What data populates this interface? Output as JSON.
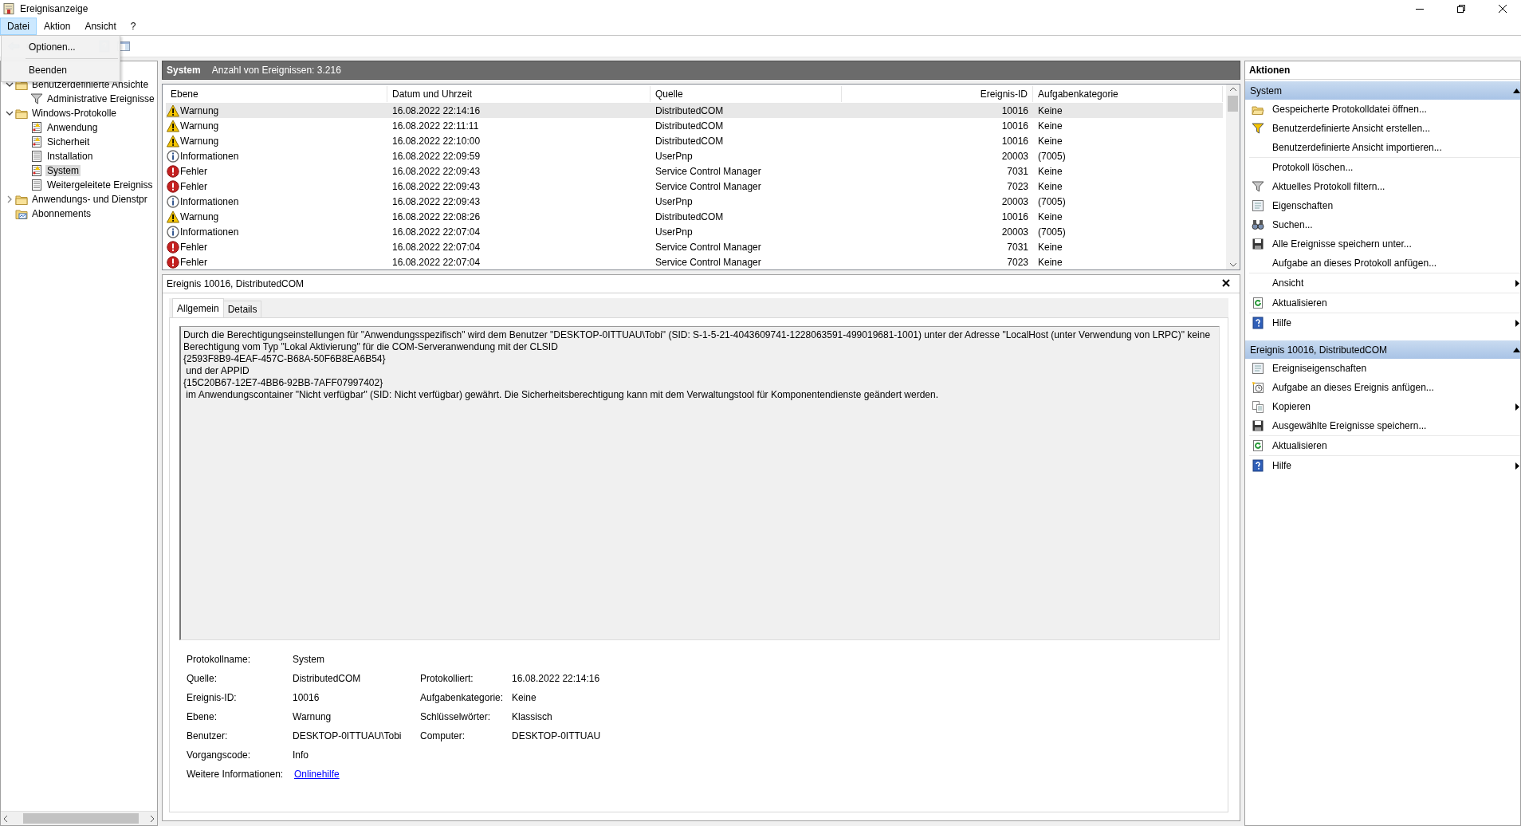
{
  "window": {
    "title": "Ereignisanzeige"
  },
  "menu": [
    {
      "label": "Datei",
      "selected": true
    },
    {
      "label": "Aktion",
      "selected": false
    },
    {
      "label": "Ansicht",
      "selected": false
    },
    {
      "label": "?",
      "selected": false
    }
  ],
  "open_menu": {
    "items": [
      "Optionen...",
      "Beenden"
    ]
  },
  "tree": [
    {
      "label": "Benutzerdefinierte Ansichte",
      "kind": "folder",
      "expanded": true,
      "selected": false,
      "children": [
        {
          "label": "Administrative Ereignisse",
          "kind": "custom_view",
          "selected": false
        }
      ]
    },
    {
      "label": "Windows-Protokolle",
      "kind": "folder",
      "expanded": true,
      "selected": false,
      "children": [
        {
          "label": "Anwendung",
          "kind": "log",
          "selected": false
        },
        {
          "label": "Sicherheit",
          "kind": "log",
          "selected": false
        },
        {
          "label": "Installation",
          "kind": "plain_log",
          "selected": false
        },
        {
          "label": "System",
          "kind": "log",
          "selected": true
        },
        {
          "label": "Weitergeleitete Ereigniss",
          "kind": "plain_log",
          "selected": false
        }
      ]
    },
    {
      "label": "Anwendungs- und Dienstpr",
      "kind": "folder",
      "expanded": false,
      "selected": false
    },
    {
      "label": "Abonnements",
      "kind": "subscriptions",
      "selected": false
    }
  ],
  "log_header": {
    "title": "System",
    "count": "Anzahl von Ereignissen: 3.216"
  },
  "table": {
    "columns": [
      "Ebene",
      "Datum und Uhrzeit",
      "Quelle",
      "Ereignis-ID",
      "Aufgabenkategorie"
    ],
    "rows": [
      {
        "kind": "warning",
        "level": "Warnung",
        "date": "16.08.2022 22:14:16",
        "source": "DistributedCOM",
        "id": "10016",
        "category": "Keine",
        "selected": true
      },
      {
        "kind": "warning",
        "level": "Warnung",
        "date": "16.08.2022 22:11:11",
        "source": "DistributedCOM",
        "id": "10016",
        "category": "Keine",
        "selected": false
      },
      {
        "kind": "warning",
        "level": "Warnung",
        "date": "16.08.2022 22:10:00",
        "source": "DistributedCOM",
        "id": "10016",
        "category": "Keine",
        "selected": false
      },
      {
        "kind": "info",
        "level": "Informationen",
        "date": "16.08.2022 22:09:59",
        "source": "UserPnp",
        "id": "20003",
        "category": "(7005)",
        "selected": false
      },
      {
        "kind": "error",
        "level": "Fehler",
        "date": "16.08.2022 22:09:43",
        "source": "Service Control Manager",
        "id": "7031",
        "category": "Keine",
        "selected": false
      },
      {
        "kind": "error",
        "level": "Fehler",
        "date": "16.08.2022 22:09:43",
        "source": "Service Control Manager",
        "id": "7023",
        "category": "Keine",
        "selected": false
      },
      {
        "kind": "info",
        "level": "Informationen",
        "date": "16.08.2022 22:09:43",
        "source": "UserPnp",
        "id": "20003",
        "category": "(7005)",
        "selected": false
      },
      {
        "kind": "warning",
        "level": "Warnung",
        "date": "16.08.2022 22:08:26",
        "source": "DistributedCOM",
        "id": "10016",
        "category": "Keine",
        "selected": false
      },
      {
        "kind": "info",
        "level": "Informationen",
        "date": "16.08.2022 22:07:04",
        "source": "UserPnp",
        "id": "20003",
        "category": "(7005)",
        "selected": false
      },
      {
        "kind": "error",
        "level": "Fehler",
        "date": "16.08.2022 22:07:04",
        "source": "Service Control Manager",
        "id": "7031",
        "category": "Keine",
        "selected": false
      },
      {
        "kind": "error",
        "level": "Fehler",
        "date": "16.08.2022 22:07:04",
        "source": "Service Control Manager",
        "id": "7023",
        "category": "Keine",
        "selected": false
      }
    ]
  },
  "detail": {
    "title": "Ereignis 10016, DistributedCOM",
    "tabs": [
      {
        "label": "Allgemein",
        "selected": true
      },
      {
        "label": "Details",
        "selected": false
      }
    ],
    "message_lines": [
      "Durch die Berechtigungseinstellungen für \"Anwendungsspezifisch\" wird dem Benutzer \"DESKTOP-0ITTUAU\\Tobi\" (SID: S-1-5-21-4043609741-1228063591-499019681-1001) unter der Adresse \"LocalHost (unter Verwendung von LRPC)\" keine",
      "Berechtigung vom Typ \"Lokal Aktivierung\" für die COM-Serveranwendung mit der CLSID",
      "{2593F8B9-4EAF-457C-B68A-50F6B8EA6B54}",
      " und der APPID",
      "{15C20B67-12E7-4BB6-92BB-7AFF07997402}",
      " im Anwendungscontainer \"Nicht verfügbar\" (SID: Nicht verfügbar) gewährt. Die Sicherheitsberechtigung kann mit dem Verwaltungstool für Komponentendienste geändert werden."
    ],
    "fields": [
      [
        {
          "label": "Protokollname:",
          "value": "System"
        }
      ],
      [
        {
          "label": "Quelle:",
          "value": "DistributedCOM"
        },
        {
          "label": "Protokolliert:",
          "value": "16.08.2022 22:14:16"
        }
      ],
      [
        {
          "label": "Ereignis-ID:",
          "value": "10016"
        },
        {
          "label": "Aufgabenkategorie:",
          "value": "Keine"
        }
      ],
      [
        {
          "label": "Ebene:",
          "value": "Warnung"
        },
        {
          "label": "Schlüsselwörter:",
          "value": "Klassisch"
        }
      ],
      [
        {
          "label": "Benutzer:",
          "value": "DESKTOP-0ITTUAU\\Tobi"
        },
        {
          "label": "Computer:",
          "value": "DESKTOP-0ITTUAU"
        }
      ],
      [
        {
          "label": "Vorgangscode:",
          "value": "Info"
        }
      ],
      [
        {
          "label": "Weitere Informationen:",
          "link": "Onlinehilfe"
        }
      ]
    ]
  },
  "actions": {
    "title": "Aktionen",
    "sections": [
      {
        "title": "System",
        "expanded": true,
        "groups": [
          [
            {
              "label": "Gespeicherte Protokolldatei öffnen...",
              "kind": "open",
              "submenu": false
            },
            {
              "label": "Benutzerdefinierte Ansicht erstellen...",
              "kind": "create_view",
              "submenu": false
            },
            {
              "label": "Benutzerdefinierte Ansicht importieren...",
              "kind": "plain",
              "submenu": false
            }
          ],
          [
            {
              "label": "Protokoll löschen...",
              "kind": "plain",
              "submenu": false
            },
            {
              "label": "Aktuelles Protokoll filtern...",
              "kind": "filter",
              "submenu": false
            },
            {
              "label": "Eigenschaften",
              "kind": "properties",
              "submenu": false
            },
            {
              "label": "Suchen...",
              "kind": "find",
              "submenu": false
            },
            {
              "label": "Alle Ereignisse speichern unter...",
              "kind": "save",
              "submenu": false
            },
            {
              "label": "Aufgabe an dieses Protokoll anfügen...",
              "kind": "plain",
              "submenu": false
            }
          ],
          [
            {
              "label": "Ansicht",
              "kind": "plain",
              "submenu": true
            }
          ],
          [
            {
              "label": "Aktualisieren",
              "kind": "refresh",
              "submenu": false
            }
          ],
          [
            {
              "label": "Hilfe",
              "kind": "help",
              "submenu": true
            }
          ]
        ]
      },
      {
        "title": "Ereignis 10016, DistributedCOM",
        "expanded": true,
        "groups": [
          [
            {
              "label": "Ereigniseigenschaften",
              "kind": "properties",
              "submenu": false
            },
            {
              "label": "Aufgabe an dieses Ereignis anfügen...",
              "kind": "task",
              "submenu": false
            },
            {
              "label": "Kopieren",
              "kind": "copy",
              "submenu": true
            },
            {
              "label": "Ausgewählte Ereignisse speichern...",
              "kind": "save",
              "submenu": false
            }
          ],
          [
            {
              "label": "Aktualisieren",
              "kind": "refresh",
              "submenu": false
            }
          ],
          [
            {
              "label": "Hilfe",
              "kind": "help",
              "submenu": true
            }
          ]
        ]
      }
    ]
  }
}
